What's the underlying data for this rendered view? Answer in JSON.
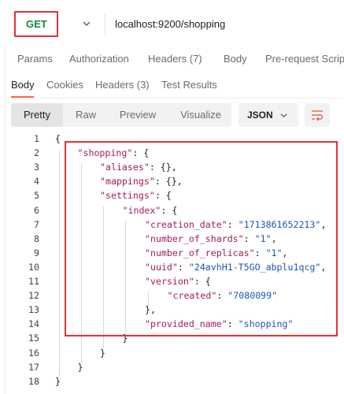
{
  "request": {
    "method": "GET",
    "url": "localhost:9200/shopping"
  },
  "request_tabs": [
    {
      "label": "Params"
    },
    {
      "label": "Authorization"
    },
    {
      "label": "Headers (7)"
    },
    {
      "label": "Body"
    },
    {
      "label": "Pre-request Scrip"
    }
  ],
  "response_tabs": [
    {
      "label": "Body",
      "active": true
    },
    {
      "label": "Cookies"
    },
    {
      "label": "Headers (3)"
    },
    {
      "label": "Test Results"
    }
  ],
  "view_modes": [
    {
      "label": "Pretty",
      "active": true
    },
    {
      "label": "Raw"
    },
    {
      "label": "Preview"
    },
    {
      "label": "Visualize"
    }
  ],
  "format": {
    "selected": "JSON"
  },
  "icons": {
    "method_dropdown": "chevron-down-icon",
    "format_dropdown": "chevron-down-icon",
    "wrap": "wrap-lines-icon"
  },
  "colors": {
    "method": "#0b8a36",
    "highlight": "#e03232",
    "json_key": "#a11d5f",
    "json_string": "#1c55b3",
    "active_tab": "#ff6c37"
  },
  "code": {
    "line_numbers": [
      "1",
      "2",
      "3",
      "4",
      "5",
      "6",
      "7",
      "8",
      "9",
      "10",
      "11",
      "12",
      "13",
      "14",
      "15",
      "16",
      "17",
      "18"
    ],
    "lines": [
      {
        "n": "1",
        "indent": 0,
        "parts": [
          {
            "t": "{",
            "c": "punc"
          }
        ]
      },
      {
        "n": "2",
        "indent": 1,
        "parts": [
          {
            "t": "\"shopping\"",
            "c": "key"
          },
          {
            "t": ": {",
            "c": "punc"
          }
        ]
      },
      {
        "n": "3",
        "indent": 2,
        "parts": [
          {
            "t": "\"aliases\"",
            "c": "key"
          },
          {
            "t": ": {},",
            "c": "punc"
          }
        ]
      },
      {
        "n": "4",
        "indent": 2,
        "parts": [
          {
            "t": "\"mappings\"",
            "c": "key"
          },
          {
            "t": ": {},",
            "c": "punc"
          }
        ]
      },
      {
        "n": "5",
        "indent": 2,
        "parts": [
          {
            "t": "\"settings\"",
            "c": "key"
          },
          {
            "t": ": {",
            "c": "punc"
          }
        ]
      },
      {
        "n": "6",
        "indent": 3,
        "parts": [
          {
            "t": "\"index\"",
            "c": "key"
          },
          {
            "t": ": {",
            "c": "punc"
          }
        ]
      },
      {
        "n": "7",
        "indent": 4,
        "parts": [
          {
            "t": "\"creation_date\"",
            "c": "key"
          },
          {
            "t": ": ",
            "c": "punc"
          },
          {
            "t": "\"1713861652213\"",
            "c": "str"
          },
          {
            "t": ",",
            "c": "punc"
          }
        ]
      },
      {
        "n": "8",
        "indent": 4,
        "parts": [
          {
            "t": "\"number_of_shards\"",
            "c": "key"
          },
          {
            "t": ": ",
            "c": "punc"
          },
          {
            "t": "\"1\"",
            "c": "str"
          },
          {
            "t": ",",
            "c": "punc"
          }
        ]
      },
      {
        "n": "9",
        "indent": 4,
        "parts": [
          {
            "t": "\"number_of_replicas\"",
            "c": "key"
          },
          {
            "t": ": ",
            "c": "punc"
          },
          {
            "t": "\"1\"",
            "c": "str"
          },
          {
            "t": ",",
            "c": "punc"
          }
        ]
      },
      {
        "n": "10",
        "indent": 4,
        "parts": [
          {
            "t": "\"uuid\"",
            "c": "key"
          },
          {
            "t": ": ",
            "c": "punc"
          },
          {
            "t": "\"24avhH1-T5GO_abplu1qcg\"",
            "c": "str"
          },
          {
            "t": ",",
            "c": "punc"
          }
        ]
      },
      {
        "n": "11",
        "indent": 4,
        "parts": [
          {
            "t": "\"version\"",
            "c": "key"
          },
          {
            "t": ": {",
            "c": "punc"
          }
        ]
      },
      {
        "n": "12",
        "indent": 5,
        "parts": [
          {
            "t": "\"created\"",
            "c": "key"
          },
          {
            "t": ": ",
            "c": "punc"
          },
          {
            "t": "\"7080099\"",
            "c": "str"
          }
        ]
      },
      {
        "n": "13",
        "indent": 4,
        "parts": [
          {
            "t": "},",
            "c": "punc"
          }
        ]
      },
      {
        "n": "14",
        "indent": 4,
        "parts": [
          {
            "t": "\"provided_name\"",
            "c": "key"
          },
          {
            "t": ": ",
            "c": "punc"
          },
          {
            "t": "\"shopping\"",
            "c": "str"
          }
        ]
      },
      {
        "n": "15",
        "indent": 3,
        "parts": [
          {
            "t": "}",
            "c": "punc"
          }
        ]
      },
      {
        "n": "16",
        "indent": 2,
        "parts": [
          {
            "t": "}",
            "c": "punc"
          }
        ]
      },
      {
        "n": "17",
        "indent": 1,
        "parts": [
          {
            "t": "}",
            "c": "punc"
          }
        ]
      },
      {
        "n": "18",
        "indent": 0,
        "parts": [
          {
            "t": "}",
            "c": "punc"
          }
        ]
      }
    ]
  }
}
